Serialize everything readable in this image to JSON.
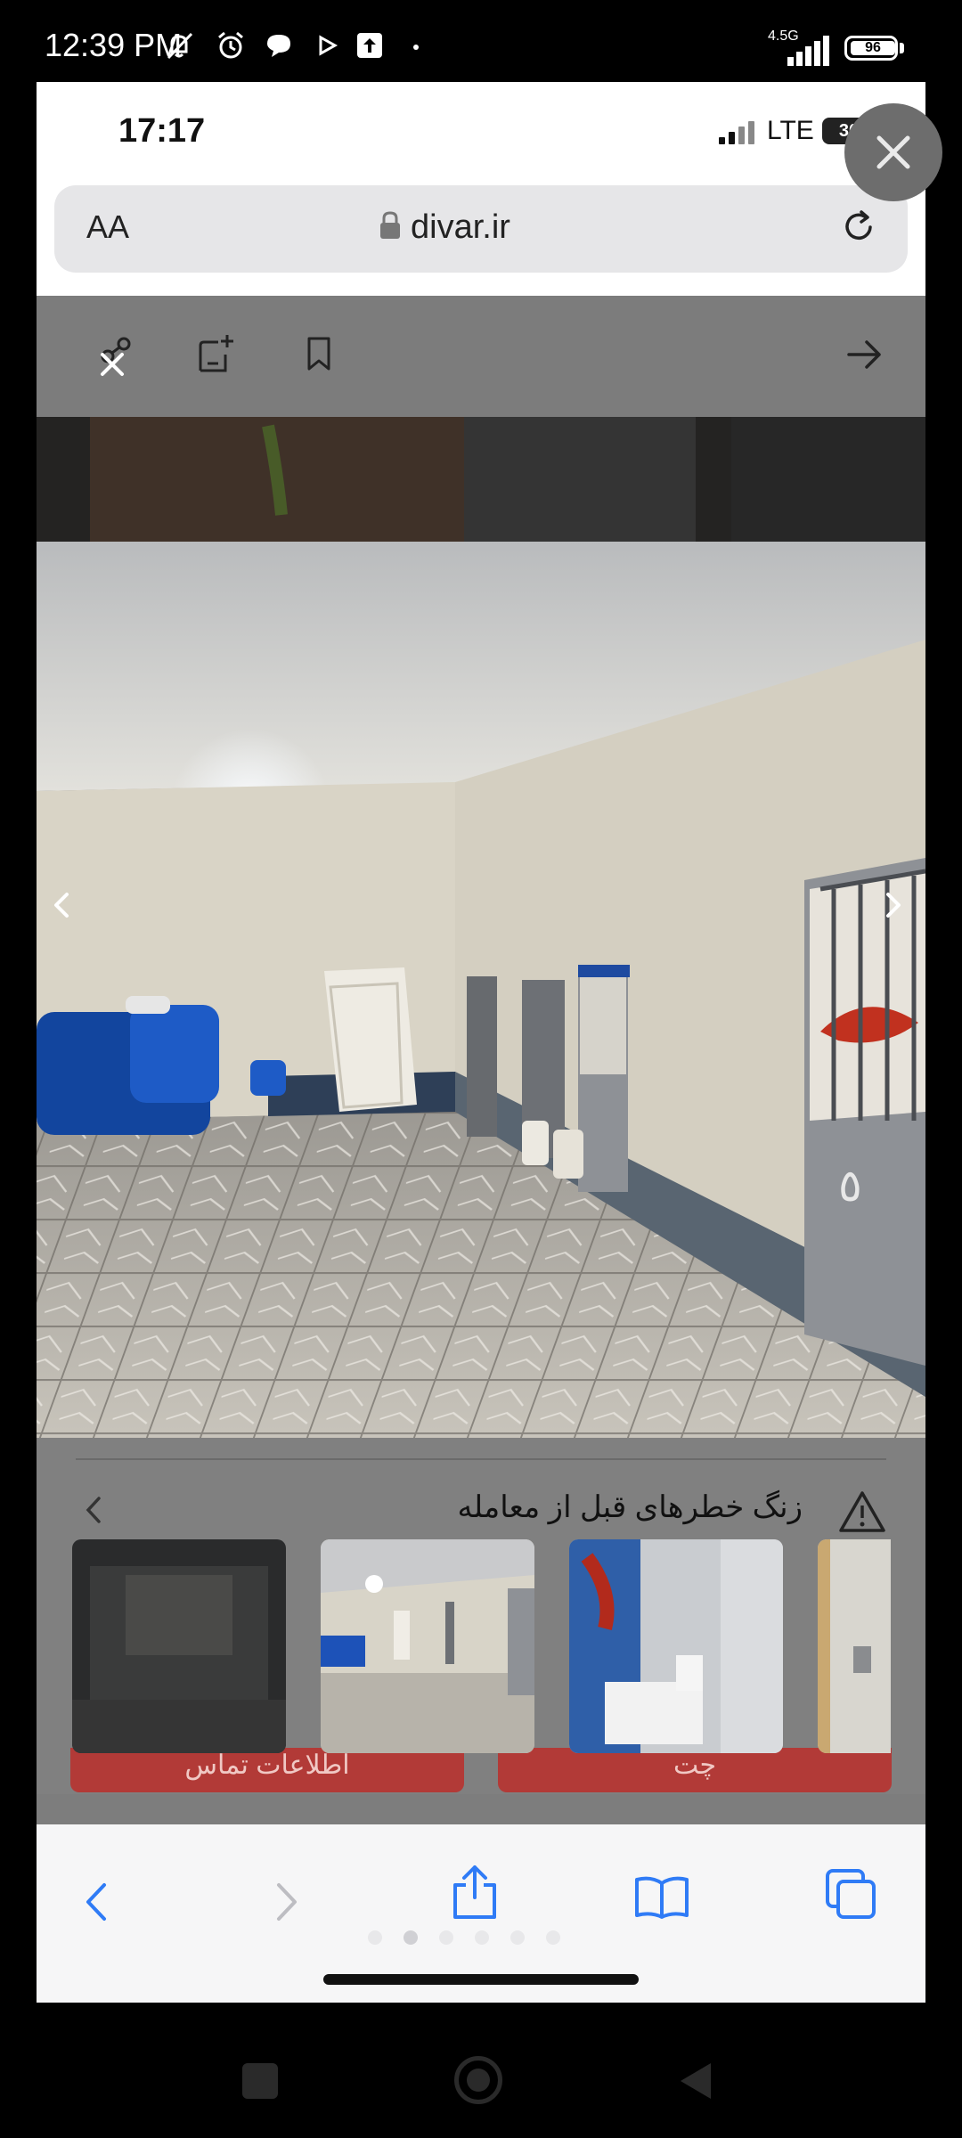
{
  "android_status": {
    "time": "12:39 PM",
    "network_speed": "4.5G",
    "battery": "96",
    "icons": [
      "no-notification-icon",
      "alarm-icon",
      "chat-bubble-icon",
      "play-icon",
      "upload-icon",
      "dot-icon",
      "signal-icon"
    ]
  },
  "ios_status": {
    "time": "17:17",
    "network": "LTE",
    "battery": "30"
  },
  "browser": {
    "text_size_label": "AA",
    "url": "divar.ir"
  },
  "listing": {
    "warning_text": "زنگ خطرهای قبل از معامله",
    "contact_button": "اطلاعات تماس",
    "chat_button": "چت"
  },
  "colors": {
    "accent_blue": "#2f7bf6",
    "button_red": "#b23a37"
  }
}
